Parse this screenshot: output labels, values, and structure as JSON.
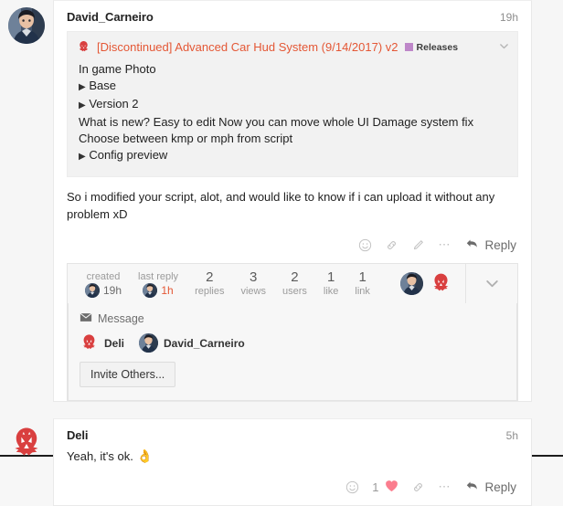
{
  "posts": [
    {
      "author": "David_Carneiro",
      "time": "19h",
      "avatar": "photo-avatar",
      "quote": {
        "title": "[Discontinued] Advanced Car Hud System (9/14/2017) v2",
        "category": "Releases",
        "category_color": "#be87c9",
        "toggle_icon": "chevron-down-icon",
        "lines": [
          "In game Photo",
          "Base",
          "Version 2",
          "What is new? Easy to edit Now you can move whole UI Damage system fix Choose between kmp or mph from script",
          "Config preview"
        ],
        "line_types": [
          "plain",
          "details",
          "details",
          "plain",
          "details"
        ]
      },
      "body": "So i modified your script, alot, and would like to know if i can upload it without any problem xD",
      "actions": {
        "emoji_label": "smiley-icon",
        "like_count": "",
        "liked": false,
        "link_label": "link-icon",
        "edit_label": "pencil-icon",
        "more_label": "ellipsis-icon",
        "reply_label": "Reply"
      }
    },
    {
      "author": "Deli",
      "time": "5h",
      "avatar": "maul-avatar",
      "body": "Yeah, it's ok.",
      "body_emoji": "👌",
      "actions": {
        "emoji_label": "smiley-icon",
        "like_count": "1",
        "liked": true,
        "link_label": "link-icon",
        "more_label": "ellipsis-icon",
        "reply_label": "Reply"
      }
    }
  ],
  "topic_map": {
    "created": {
      "label": "created",
      "value": "19h"
    },
    "last_reply": {
      "label": "last reply",
      "value": "1h"
    },
    "stats": [
      {
        "num": "2",
        "label": "replies"
      },
      {
        "num": "3",
        "label": "views"
      },
      {
        "num": "2",
        "label": "users"
      },
      {
        "num": "1",
        "label": "like"
      },
      {
        "num": "1",
        "label": "link"
      }
    ],
    "expand_icon": "chevron-down-icon"
  },
  "private_message": {
    "title": "Message",
    "title_icon": "envelope-icon",
    "participants": [
      {
        "name": "Deli",
        "avatar": "maul-avatar"
      },
      {
        "name": "David_Carneiro",
        "avatar": "photo-avatar"
      }
    ],
    "invite_label": "Invite Others..."
  },
  "colors": {
    "accent": "#e45735",
    "heart": "#fb7d8e",
    "category": "#be87c9",
    "page_bg": "#f6f6f6",
    "card_bg": "#ffffff"
  }
}
